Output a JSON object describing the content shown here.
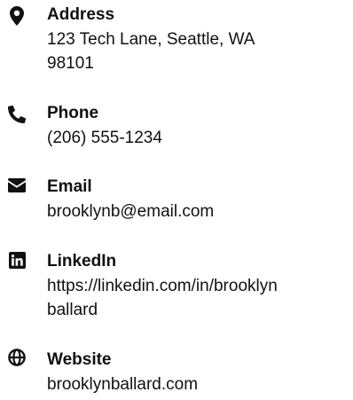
{
  "contacts": [
    {
      "icon": "map-marker-icon",
      "label": "Address",
      "lines": [
        "123 Tech Lane, Seattle, WA",
        "98101"
      ]
    },
    {
      "icon": "phone-icon",
      "label": "Phone",
      "lines": [
        "(206) 555-1234"
      ]
    },
    {
      "icon": "envelope-icon",
      "label": "Email",
      "lines": [
        "brooklynb@email.com"
      ]
    },
    {
      "icon": "linkedin-icon",
      "label": "LinkedIn",
      "lines": [
        "https://linkedin.com/in/brooklyn",
        "ballard"
      ]
    },
    {
      "icon": "globe-icon",
      "label": "Website",
      "lines": [
        "brooklynballard.com"
      ]
    }
  ]
}
